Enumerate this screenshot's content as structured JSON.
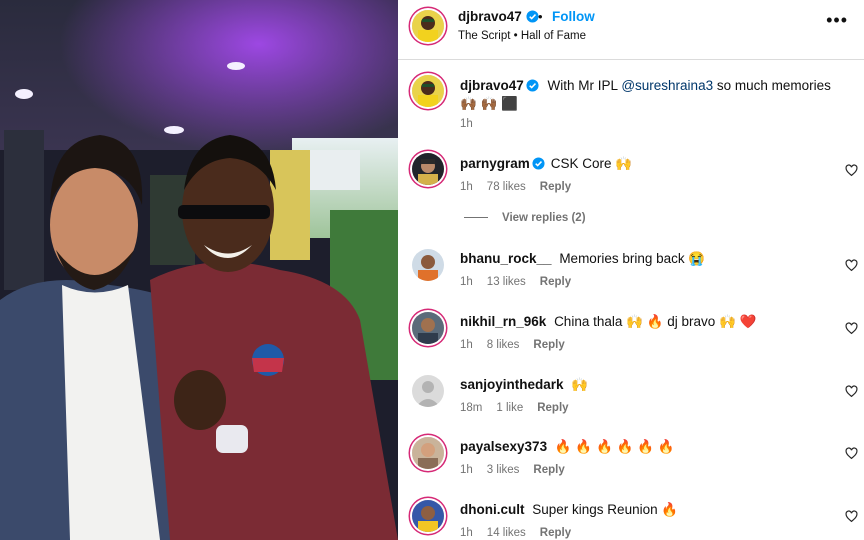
{
  "post": {
    "author": "djbravo47",
    "follow_label": "Follow",
    "separator": "•",
    "audio": "The Script • Hall of Fame",
    "more_label": "•••"
  },
  "caption": {
    "user": "djbravo47",
    "text_before": "With Mr IPL",
    "mention": "@sureshraina3",
    "text_after": "so much memories 🙌🏾 🙌🏾 ⬛",
    "time": "1h"
  },
  "comments": [
    {
      "user": "parnygram",
      "verified": true,
      "text": "CSK Core 🙌",
      "time": "1h",
      "likes": "78 likes",
      "reply": "Reply"
    },
    {
      "user": "bhanu_rock__",
      "verified": false,
      "text": "Memories bring back 😭",
      "time": "1h",
      "likes": "13 likes",
      "reply": "Reply"
    },
    {
      "user": "nikhil_rn_96k",
      "verified": false,
      "text": "China thala 🙌 🔥 dj bravo 🙌 ❤️",
      "time": "1h",
      "likes": "8 likes",
      "reply": "Reply"
    },
    {
      "user": "sanjoyinthedark",
      "verified": false,
      "text": "🙌",
      "time": "18m",
      "likes": "1 like",
      "reply": "Reply"
    },
    {
      "user": "payalsexy373",
      "verified": false,
      "text": "🔥 🔥 🔥 🔥 🔥 🔥",
      "time": "1h",
      "likes": "3 likes",
      "reply": "Reply"
    },
    {
      "user": "dhoni.cult",
      "verified": false,
      "text": "Super kings Reunion 🔥",
      "time": "1h",
      "likes": "14 likes",
      "reply": "Reply"
    }
  ],
  "view_replies_label": "View replies (2)",
  "colors": {
    "link": "#0095f6",
    "mention": "#00376b",
    "muted": "#737373",
    "verified": "#0095f6"
  },
  "icons": {
    "verified": "verified-badge-icon",
    "like": "heart-outline-icon",
    "more": "more-options-icon"
  }
}
